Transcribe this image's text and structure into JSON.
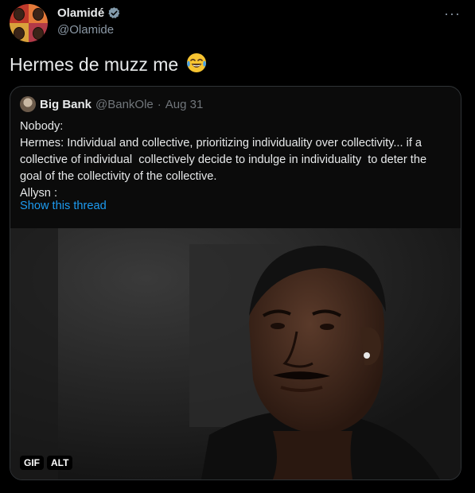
{
  "author": {
    "display_name": "Olamidé",
    "handle": "@Olamide",
    "verified": true
  },
  "tweet": {
    "text": "Hermes de muzz me",
    "emoji": "face-with-tears-of-joy"
  },
  "quoted_tweet": {
    "display_name": "Big Bank",
    "handle": "@BankOle",
    "separator": "·",
    "date": "Aug 31",
    "lines": [
      "Nobody:",
      "Hermes: Individual and collective, prioritizing individuality over collectivity... if a",
      "collective of individual  collectively decide to indulge in individuality  to deter the",
      "goal of the collectivity of the collective.",
      "Allysn :"
    ],
    "show_thread_label": "Show this thread",
    "media": {
      "gif_label": "GIF",
      "alt_label": "ALT"
    }
  },
  "ui": {
    "more_label": "···"
  },
  "colors": {
    "background": "#000000",
    "text": "#e7e9ea",
    "muted": "#71767b",
    "link": "#1d9bf0",
    "verified": "#829aab",
    "border": "#2f3336"
  }
}
